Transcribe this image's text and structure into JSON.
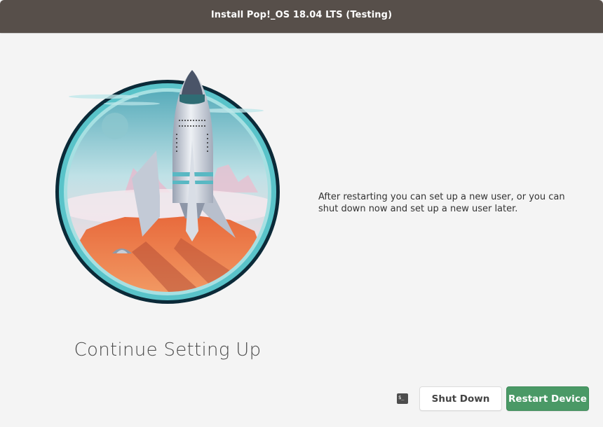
{
  "window": {
    "title": "Install Pop!_OS 18.04 LTS (Testing)"
  },
  "main": {
    "heading": "Continue Setting Up",
    "description": "After restarting you can set up a new user, or you can shut down now and set up a new user later.",
    "illustration_icon": "rocket-on-mars-icon"
  },
  "actions": {
    "terminal_icon": "terminal-icon",
    "terminal_glyph": "$_",
    "shutdown_label": "Shut Down",
    "restart_label": "Restart Device"
  },
  "colors": {
    "titlebar": "#574f4a",
    "accent_restart": "#4a9966",
    "background": "#f4f4f4"
  }
}
